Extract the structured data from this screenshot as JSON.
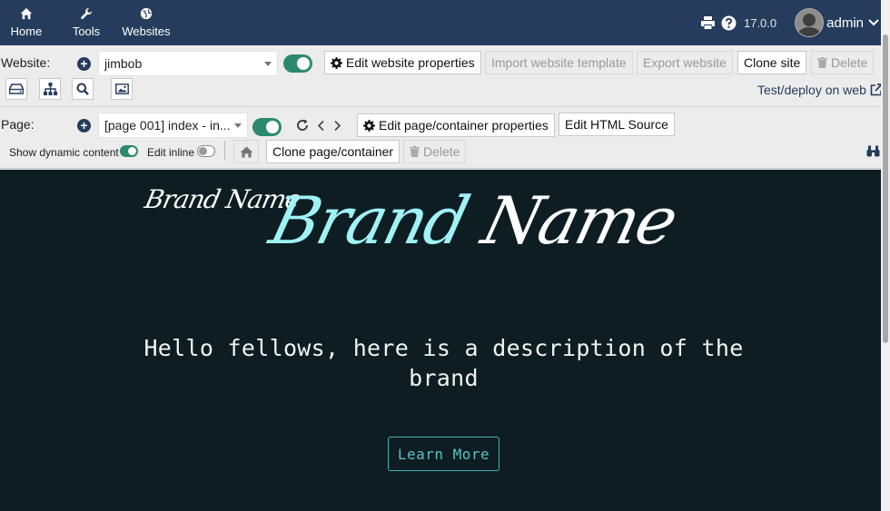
{
  "nav": {
    "items": [
      {
        "label": "Home",
        "icon": "home-icon"
      },
      {
        "label": "Tools",
        "icon": "wrench-icon"
      },
      {
        "label": "Websites",
        "icon": "globe-icon"
      }
    ],
    "version": "17.0.0",
    "user": "admin"
  },
  "website_bar": {
    "label": "Website:",
    "selected": "jimbob",
    "edit_props": "Edit website properties",
    "import_template": "Import website template",
    "export": "Export website",
    "clone": "Clone site",
    "delete": "Delete",
    "deploy": "Test/deploy on web"
  },
  "page_bar": {
    "label": "Page:",
    "selected": "[page 001] index - in...",
    "edit_props": "Edit page/container properties",
    "edit_html": "Edit HTML Source",
    "show_dynamic": "Show dynamic content",
    "edit_inline": "Edit inline",
    "clone": "Clone page/container",
    "delete": "Delete"
  },
  "preview": {
    "brand_small": "Brand Name",
    "brand_big_first": "Brand",
    "brand_big_rest": " Name",
    "description": "Hello fellows, here is a description of the brand",
    "cta": "Learn More"
  },
  "colors": {
    "nav_bg": "#263c5c",
    "toggle_on": "#2b8a6e",
    "preview_bg": "#0d1d22",
    "brand_accent": "#9ff2f5",
    "cta": "#5fbfc4"
  }
}
